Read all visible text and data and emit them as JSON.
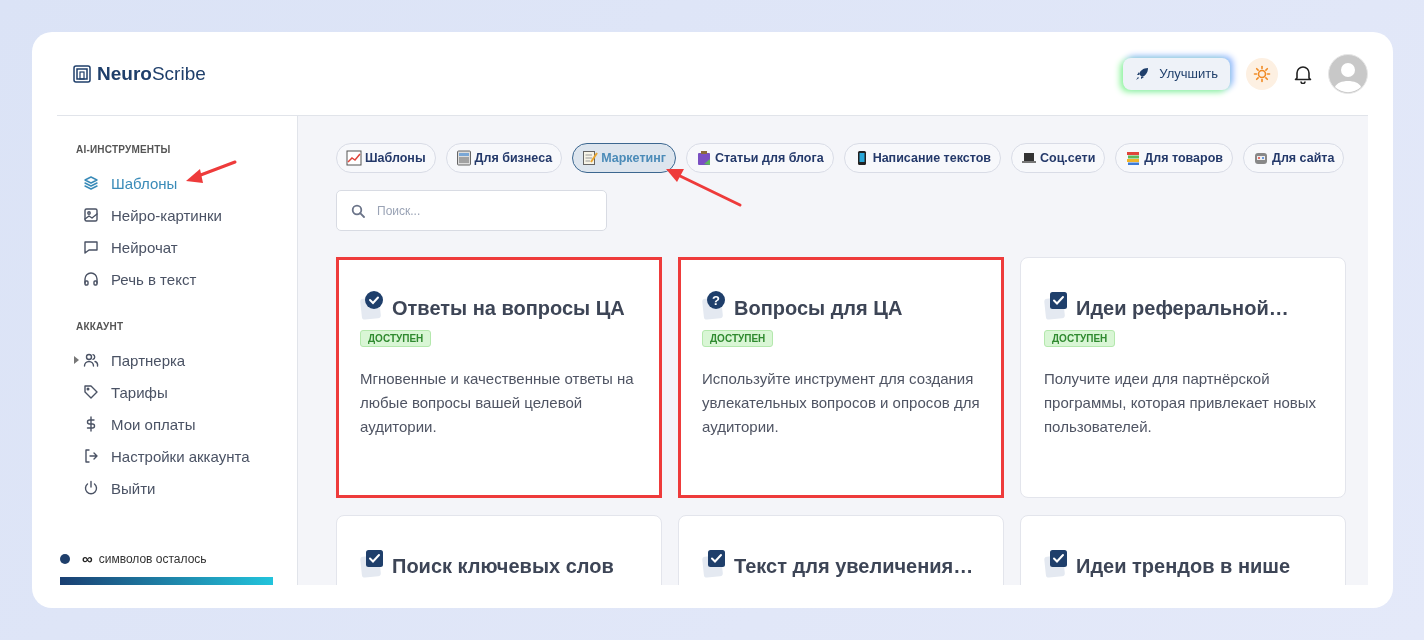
{
  "app": {
    "logo_bold": "Neuro",
    "logo_light": "Scribe"
  },
  "header": {
    "upgrade_button": "Улучшить"
  },
  "sidebar": {
    "sections": [
      {
        "title": "AI-ИНСТРУМЕНТЫ",
        "items": [
          {
            "label": "Шаблоны",
            "selected": true
          },
          {
            "label": "Нейро-картинки",
            "selected": false
          },
          {
            "label": "Нейрочат",
            "selected": false
          },
          {
            "label": "Речь в текст",
            "selected": false
          }
        ]
      },
      {
        "title": "АККАУНТ",
        "items": [
          {
            "label": "Партнерка",
            "selected": false,
            "expanded": false
          },
          {
            "label": "Тарифы",
            "selected": false
          },
          {
            "label": "Мои оплаты",
            "selected": false
          },
          {
            "label": "Настройки аккаунта",
            "selected": false
          },
          {
            "label": "Выйти",
            "selected": false
          }
        ]
      }
    ],
    "credits": {
      "amount": "∞",
      "label": "символов осталось",
      "level": 1
    }
  },
  "tabs": [
    {
      "label": "Шаблоны",
      "selected": false
    },
    {
      "label": "Для бизнеса",
      "selected": false
    },
    {
      "label": "Маркетинг",
      "selected": true
    },
    {
      "label": "Статьи для блога",
      "selected": false
    },
    {
      "label": "Написание текстов",
      "selected": false
    },
    {
      "label": "Соц.сети",
      "selected": false
    },
    {
      "label": "Для товаров",
      "selected": false
    },
    {
      "label": "Для сайта",
      "selected": false
    }
  ],
  "search": {
    "placeholder": "Поиск..."
  },
  "cards": [
    {
      "title": "Ответы на вопросы ЦА",
      "kind": "check",
      "badge": "ДОСТУПЕН",
      "description": "Мгновенные и качественные ответы на любые вопросы вашей целевой аудитории.",
      "highlighted": true
    },
    {
      "title": "Вопросы для ЦА",
      "kind": "question",
      "mark": "?",
      "badge": "ДОСТУПЕН",
      "description": "Используйте инструмент для создания увлекательных вопросов и опросов для аудитории.",
      "highlighted": true
    },
    {
      "title": "Идеи реферальной…",
      "kind": "checkbox",
      "badge": "ДОСТУПЕН",
      "description": "Получите идеи для партнёрской программы, которая привлекает новых пользователей.",
      "highlighted": false
    },
    {
      "title": "Поиск ключевых слов",
      "kind": "checkbox",
      "highlighted": false
    },
    {
      "title": "Текст для увеличения…",
      "kind": "checkbox",
      "highlighted": false
    },
    {
      "title": "Идеи трендов в нише",
      "kind": "checkbox",
      "highlighted": false
    }
  ]
}
